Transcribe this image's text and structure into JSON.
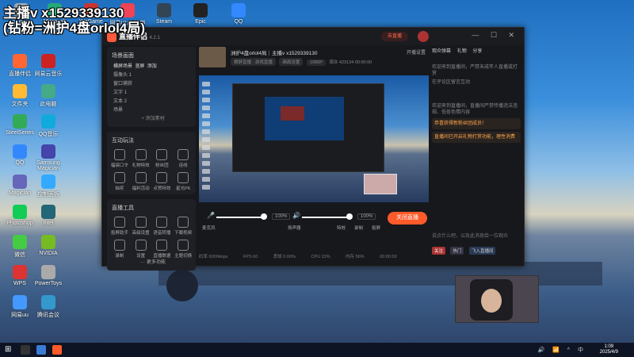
{
  "overlay": {
    "line1": "主播v x1529339130",
    "line2": "(钻粉=洲护4盘orlol4局)"
  },
  "desktop_icons": [
    {
      "label": "回收站"
    },
    {
      "label": "Microsoft Edge"
    },
    {
      "label": "WeGame"
    },
    {
      "label": "网易UU加速器"
    },
    {
      "label": "Steam"
    },
    {
      "label": "Epic"
    },
    {
      "label": "QQ"
    },
    {
      "label": "直播伴侣"
    },
    {
      "label": "网易云音乐"
    },
    {
      "label": "文件夹"
    },
    {
      "label": "此电脑"
    },
    {
      "label": "SteelSeries"
    },
    {
      "label": "QQ音乐"
    },
    {
      "label": "QQ"
    },
    {
      "label": "Samsung Magician"
    },
    {
      "label": "Magician"
    },
    {
      "label": "控制面板"
    },
    {
      "label": "Photoshop"
    },
    {
      "label": "Intel"
    },
    {
      "label": "微信"
    },
    {
      "label": "NVIDIA"
    },
    {
      "label": "WPS"
    },
    {
      "label": "PowerToys"
    },
    {
      "label": "网易uu"
    },
    {
      "label": "腾讯会议"
    }
  ],
  "app": {
    "name": "直播伴侣",
    "version": "4.2.1",
    "go_live_label": "去直播",
    "window_controls": "— ☐ ✕",
    "left": {
      "scenes_title": "场景画面",
      "scene_tabs": [
        "横屏场景",
        "竖屏",
        "添加"
      ],
      "sources": [
        "摄像头 1",
        "窗口捕获",
        "文字 1",
        "文本 2",
        "场景"
      ],
      "add_source": "+ 添加素材",
      "interact_title": "互动玩法",
      "interact_tools": [
        "福袋口令",
        "礼物特效",
        "粉丝团",
        "连线",
        "抽奖",
        "福利活动",
        "点赞特效",
        "星光PK"
      ],
      "tools_title": "直播工具",
      "tools": [
        "投屏助手",
        "高级设置",
        "语音转播",
        "下载视频",
        "录制",
        "设置",
        "直播数据",
        "主题切换"
      ],
      "more": "··· 更多功能"
    },
    "center": {
      "stream_title": "洲护4盘orlol4局｜主播v x1529339130",
      "start_link": "开播设置",
      "chips": [
        "横屏直播 · 游戏直播",
        "画面设置",
        "1080P",
        "观众 423134",
        "00:00:00"
      ],
      "mic_label": "麦克风",
      "mic_pct": "100%",
      "speaker_label": "扬声器",
      "speaker_pct": "100%",
      "btn_fx": "特效",
      "btn_record": "录制",
      "btn_screen": "投屏",
      "live_btn": "关闭直播",
      "stats": [
        "码率 6000kbps",
        "FPS 60",
        "丢帧 0.00%",
        "CPU 23%",
        "内存 56%",
        "00:00:00"
      ]
    },
    "right": {
      "tabs": [
        "观众弹幕",
        "礼物",
        "分享"
      ],
      "msgs": [
        "欢迎来到直播间，严禁未成年人直播或打赏",
        "在评论区留言互动",
        "欢迎来到直播间，直播间严禁传播违法违规、低俗色情内容",
        "恭喜获得新粉丝团成员！",
        "直播间已开启礼物打赏功能，理性消费"
      ],
      "input_placeholder": "说点什么吧，以及此消息给一位观众",
      "badges": [
        "关注",
        "热门",
        "飞入直播间"
      ]
    }
  },
  "taskbar": {
    "time": "1:09",
    "date": "2025/4/9",
    "tray": "🔊 📶 ^ 中"
  },
  "colors": {
    "accent": "#ff5a2a",
    "app_bg": "#17181c",
    "card_bg": "#1f2025"
  }
}
